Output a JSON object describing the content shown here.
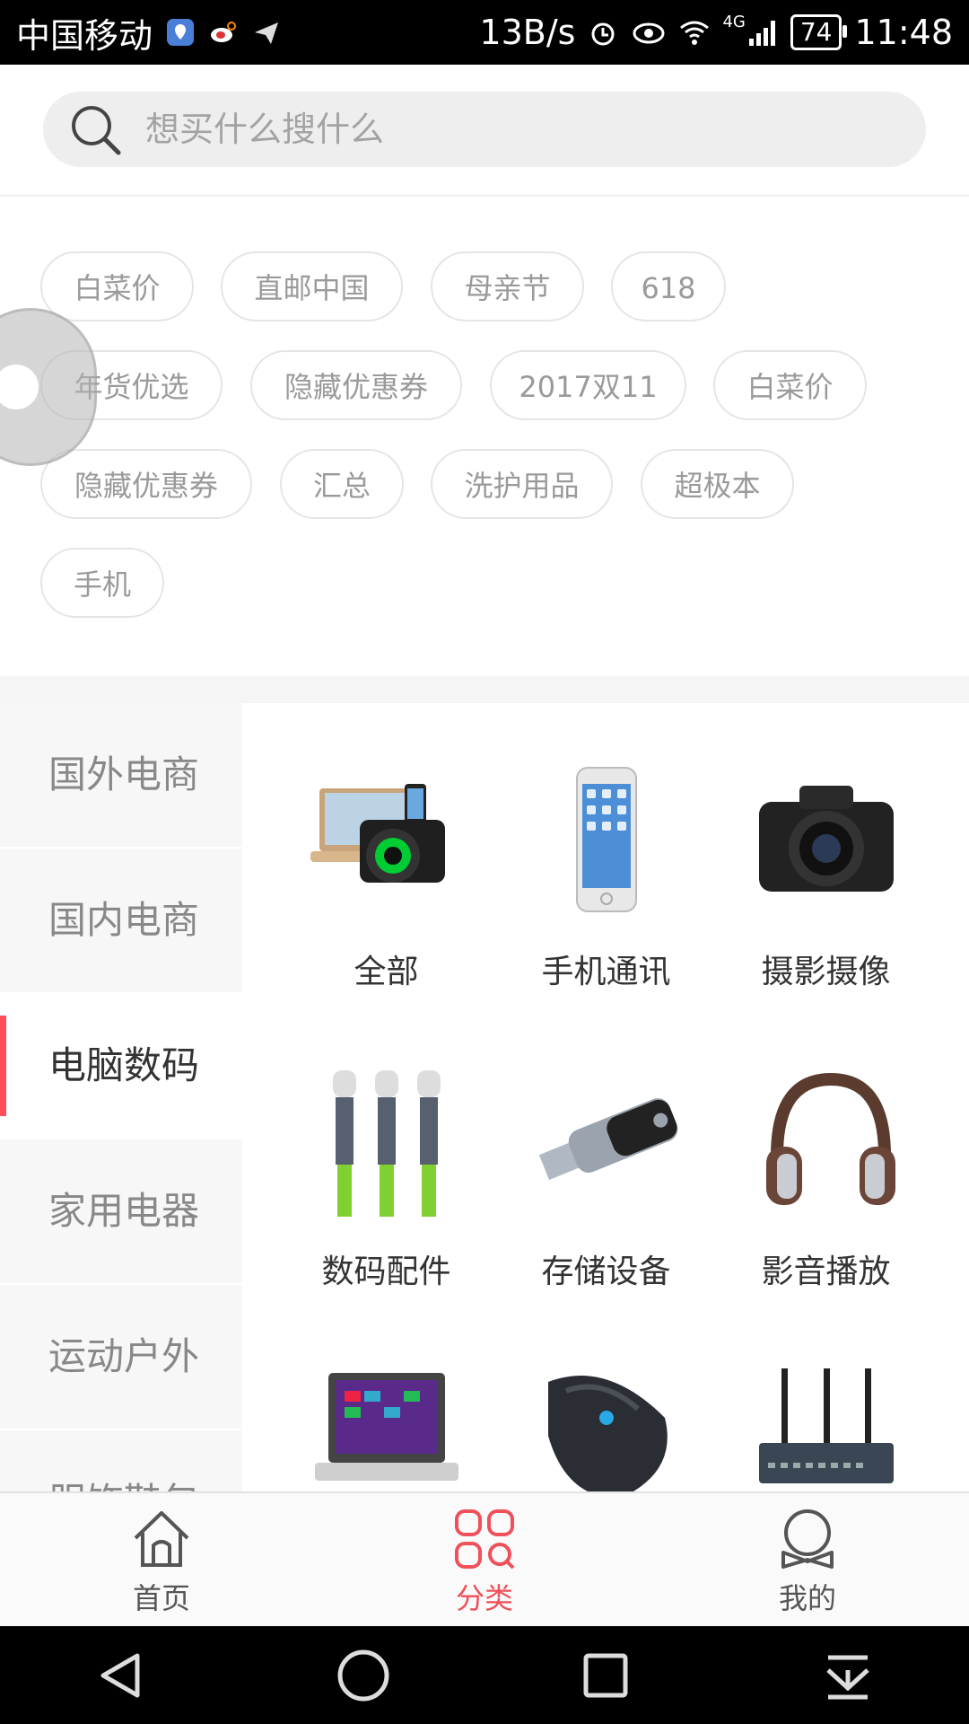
{
  "status_bar": {
    "carrier": "中国移动",
    "speed": "13B/s",
    "battery": "74",
    "time": "11:48",
    "network": "4G"
  },
  "search": {
    "placeholder": "想买什么搜什么"
  },
  "tags": [
    "白菜价",
    "直邮中国",
    "母亲节",
    "618",
    "年货优选",
    "隐藏优惠券",
    "2017双11",
    "白菜价",
    "隐藏优惠券",
    "汇总",
    "洗护用品",
    "超极本",
    "手机"
  ],
  "sidebar": {
    "items": [
      {
        "label": "国外电商"
      },
      {
        "label": "国内电商"
      },
      {
        "label": "电脑数码"
      },
      {
        "label": "家用电器"
      },
      {
        "label": "运动户外"
      },
      {
        "label": "服饰鞋包"
      }
    ],
    "active_index": 2
  },
  "categories": [
    {
      "label": "全部",
      "icon": "camera-laptop-bundle-icon"
    },
    {
      "label": "手机通讯",
      "icon": "smartphone-icon"
    },
    {
      "label": "摄影摄像",
      "icon": "dslr-camera-icon"
    },
    {
      "label": "数码配件",
      "icon": "usb-cable-icon"
    },
    {
      "label": "存储设备",
      "icon": "usb-flash-drive-icon"
    },
    {
      "label": "影音播放",
      "icon": "headphones-icon"
    },
    {
      "label": "",
      "icon": "laptop-icon"
    },
    {
      "label": "",
      "icon": "gaming-mouse-icon"
    },
    {
      "label": "",
      "icon": "router-icon"
    }
  ],
  "bottom_nav": {
    "items": [
      {
        "label": "首页",
        "icon": "home-icon"
      },
      {
        "label": "分类",
        "icon": "category-grid-icon"
      },
      {
        "label": "我的",
        "icon": "profile-icon"
      }
    ],
    "active_index": 1
  },
  "colors": {
    "accent": "#f0505a",
    "tag_border": "#e5e5e5",
    "sidebar_bg": "#f7f7f7"
  }
}
